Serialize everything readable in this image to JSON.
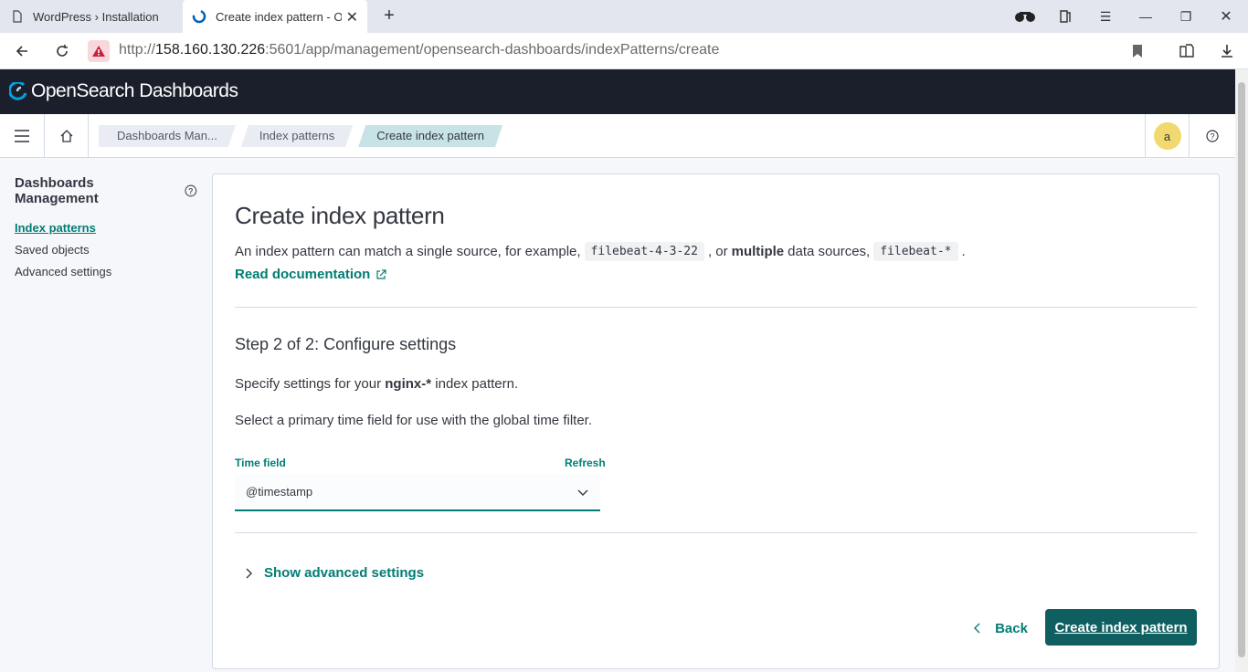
{
  "browser": {
    "tabs": [
      {
        "title": "WordPress › Installation",
        "active": false
      },
      {
        "title": "Create index pattern - O",
        "active": true
      }
    ],
    "url_prefix": "http://",
    "url_host": "158.160.130.226",
    "url_rest": ":5601/app/management/opensearch-dashboards/indexPatterns/create"
  },
  "app": {
    "logo_text": "OpenSearch Dashboards",
    "avatar_letter": "a"
  },
  "breadcrumbs": [
    "Dashboards Man...",
    "Index patterns",
    "Create index pattern"
  ],
  "sidenav": {
    "title": "Dashboards Management",
    "items": [
      "Index patterns",
      "Saved objects",
      "Advanced settings"
    ]
  },
  "main": {
    "title": "Create index pattern",
    "desc_1": "An index pattern can match a single source, for example,",
    "code_1": "filebeat-4-3-22",
    "desc_2": ", or",
    "desc_bold": "multiple",
    "desc_3": "data sources,",
    "code_2": "filebeat-*",
    "desc_4": ".",
    "doc_link": "Read documentation",
    "step_title": "Step 2 of 2: Configure settings",
    "specify_pre": "Specify settings for your",
    "specify_pattern": "nginx-*",
    "specify_post": "index pattern.",
    "select_help": "Select a primary time field for use with the global time filter.",
    "time_field_label": "Time field",
    "refresh_label": "Refresh",
    "time_field_value": "@timestamp",
    "advanced_label": "Show advanced settings",
    "back_label": "Back",
    "create_label": "Create index pattern"
  },
  "colors": {
    "accent": "#017d73",
    "header_bg": "#1a1f2b",
    "primary_button": "#0f5e60"
  }
}
